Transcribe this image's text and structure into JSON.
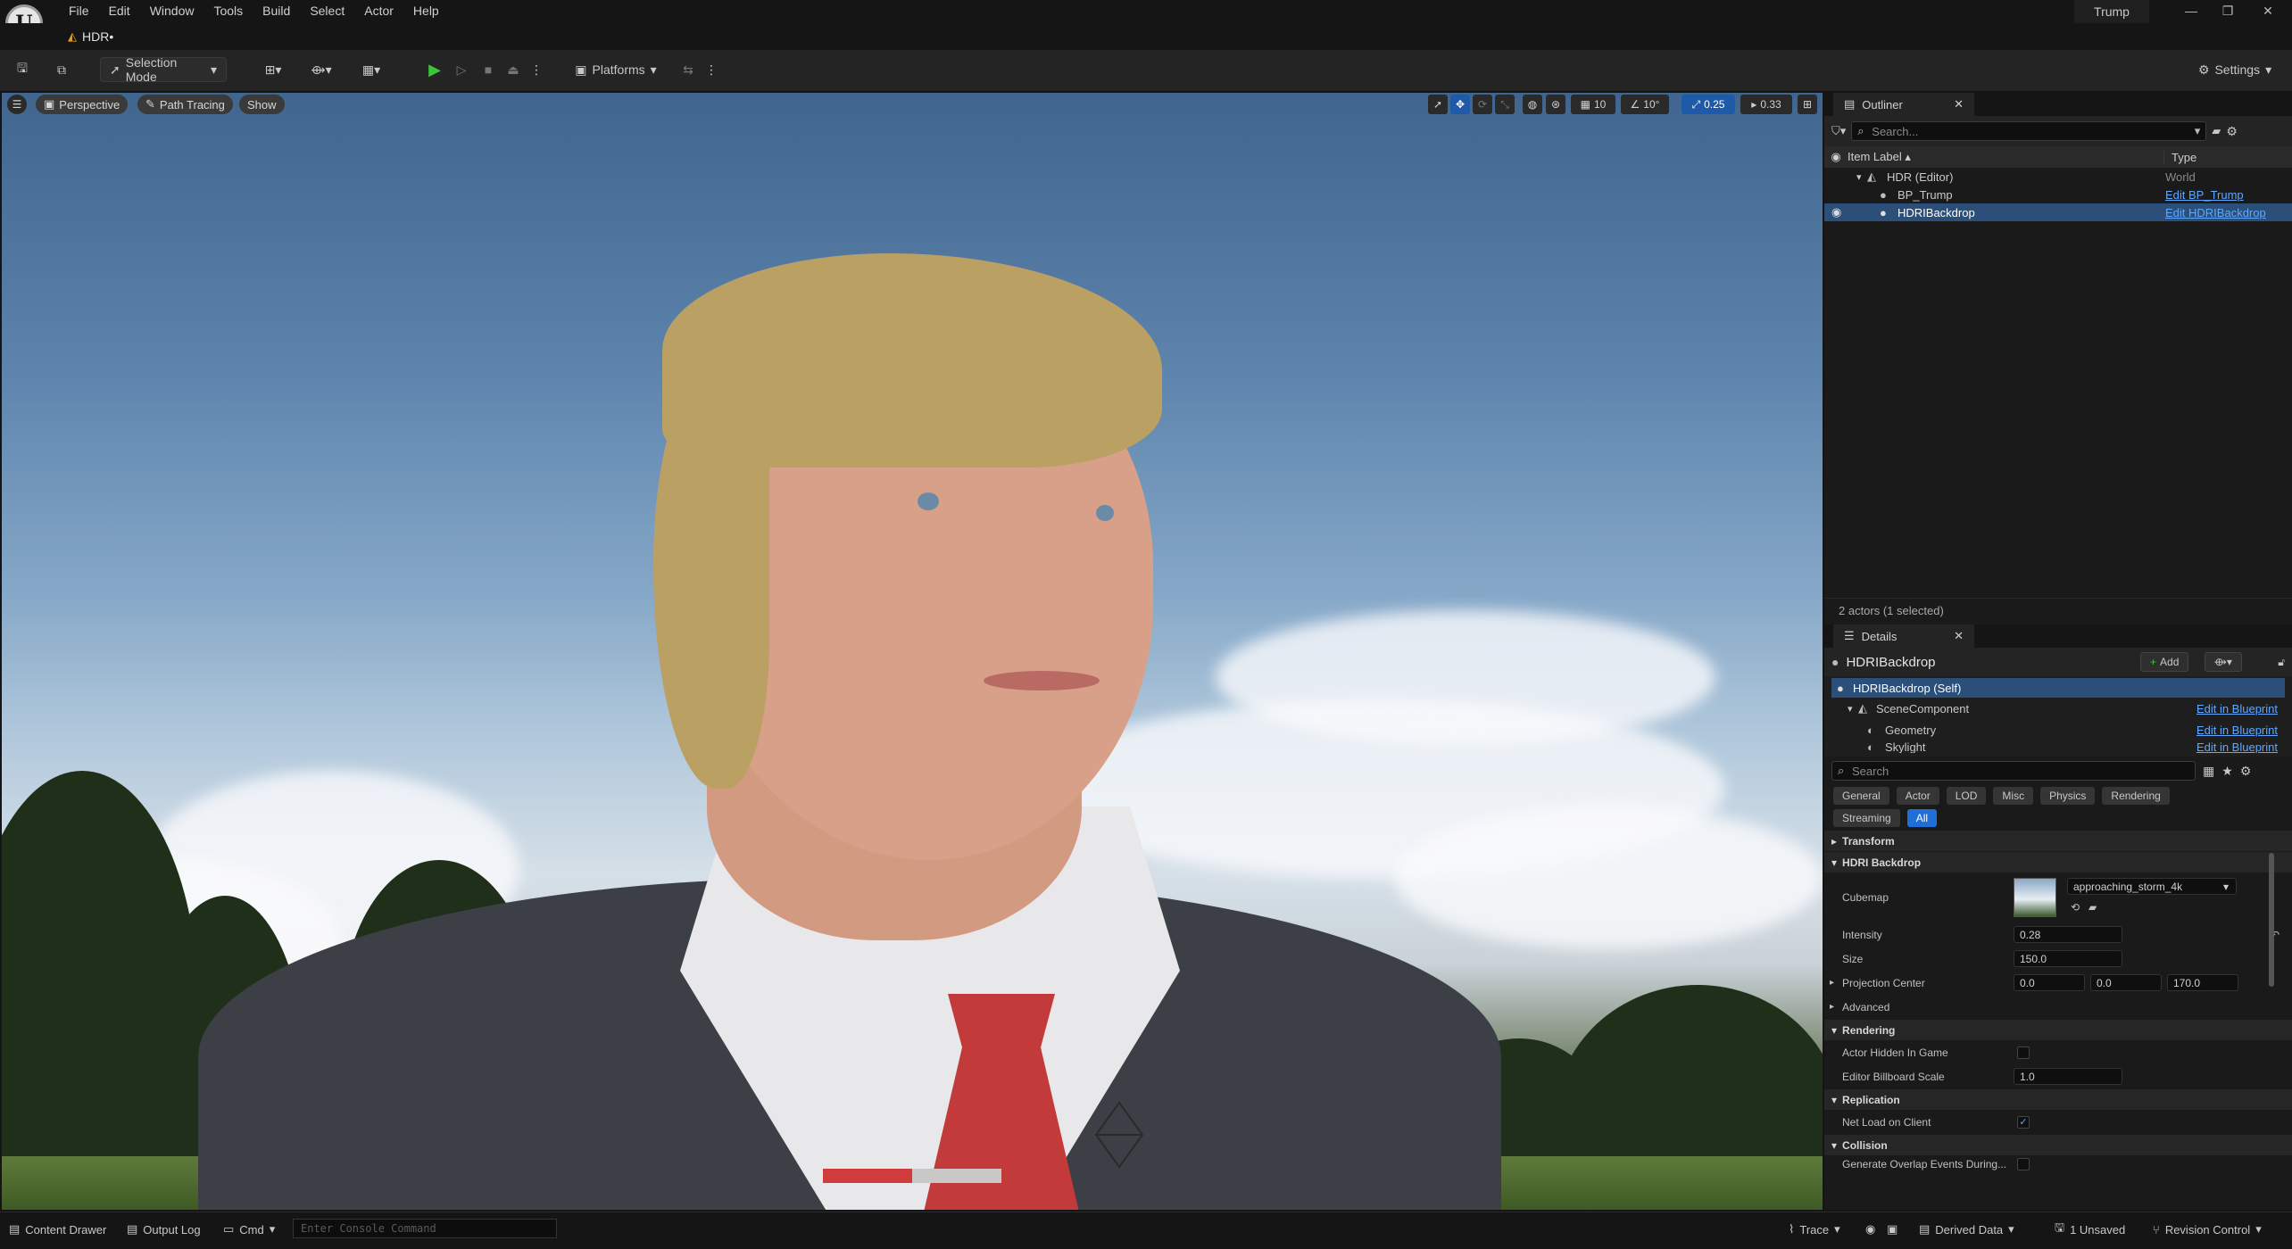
{
  "menu": [
    "File",
    "Edit",
    "Window",
    "Tools",
    "Build",
    "Select",
    "Actor",
    "Help"
  ],
  "project_name": "Trump",
  "level_tab": "HDR•",
  "toolbar": {
    "selection_mode": "Selection Mode",
    "platforms": "Platforms",
    "settings": "Settings"
  },
  "viewport": {
    "perspective": "Perspective",
    "view_mode": "Path Tracing",
    "show": "Show",
    "grid_snap": "10",
    "rotation_snap": "10°",
    "scale_snap": "0.25",
    "camera_speed": "0.33",
    "progress": 0.5
  },
  "outliner": {
    "tab": "Outliner",
    "search_placeholder": "Search...",
    "col_label": "Item Label",
    "col_type": "Type",
    "rows": [
      {
        "label": "HDR (Editor)",
        "type": "World"
      },
      {
        "label": "BP_Trump",
        "type": "Edit BP_Trump"
      },
      {
        "label": "HDRIBackdrop",
        "type": "Edit HDRIBackdrop"
      }
    ],
    "footer": "2 actors (1 selected)"
  },
  "details": {
    "tab": "Details",
    "actor_name": "HDRIBackdrop",
    "add_label": "Add",
    "components": [
      {
        "label": "HDRIBackdrop (Self)",
        "link": ""
      },
      {
        "label": "SceneComponent",
        "link": "Edit in Blueprint"
      },
      {
        "label": "Geometry",
        "link": "Edit in Blueprint"
      },
      {
        "label": "Skylight",
        "link": "Edit in Blueprint"
      }
    ],
    "search_placeholder": "Search",
    "categories": [
      "General",
      "Actor",
      "LOD",
      "Misc",
      "Physics",
      "Rendering",
      "Streaming",
      "All"
    ],
    "sections": {
      "transform": "Transform",
      "hdri_backdrop": "HDRI Backdrop",
      "advanced": "Advanced",
      "rendering": "Rendering",
      "replication": "Replication",
      "collision": "Collision"
    },
    "props": {
      "cubemap_label": "Cubemap",
      "cubemap_value": "approaching_storm_4k",
      "intensity_label": "Intensity",
      "intensity_value": "0.28",
      "size_label": "Size",
      "size_value": "150.0",
      "projection_label": "Projection Center",
      "proj_x": "0.0",
      "proj_y": "0.0",
      "proj_z": "170.0",
      "hidden_label": "Actor Hidden In Game",
      "billboard_label": "Editor Billboard Scale",
      "billboard_value": "1.0",
      "netload_label": "Net Load on Client",
      "overlap_label": "Generate Overlap Events During..."
    }
  },
  "statusbar": {
    "content_drawer": "Content Drawer",
    "output_log": "Output Log",
    "cmd": "Cmd",
    "console_placeholder": "Enter Console Command",
    "trace": "Trace",
    "derived_data": "Derived Data",
    "unsaved": "1 Unsaved",
    "revision_control": "Revision Control"
  }
}
